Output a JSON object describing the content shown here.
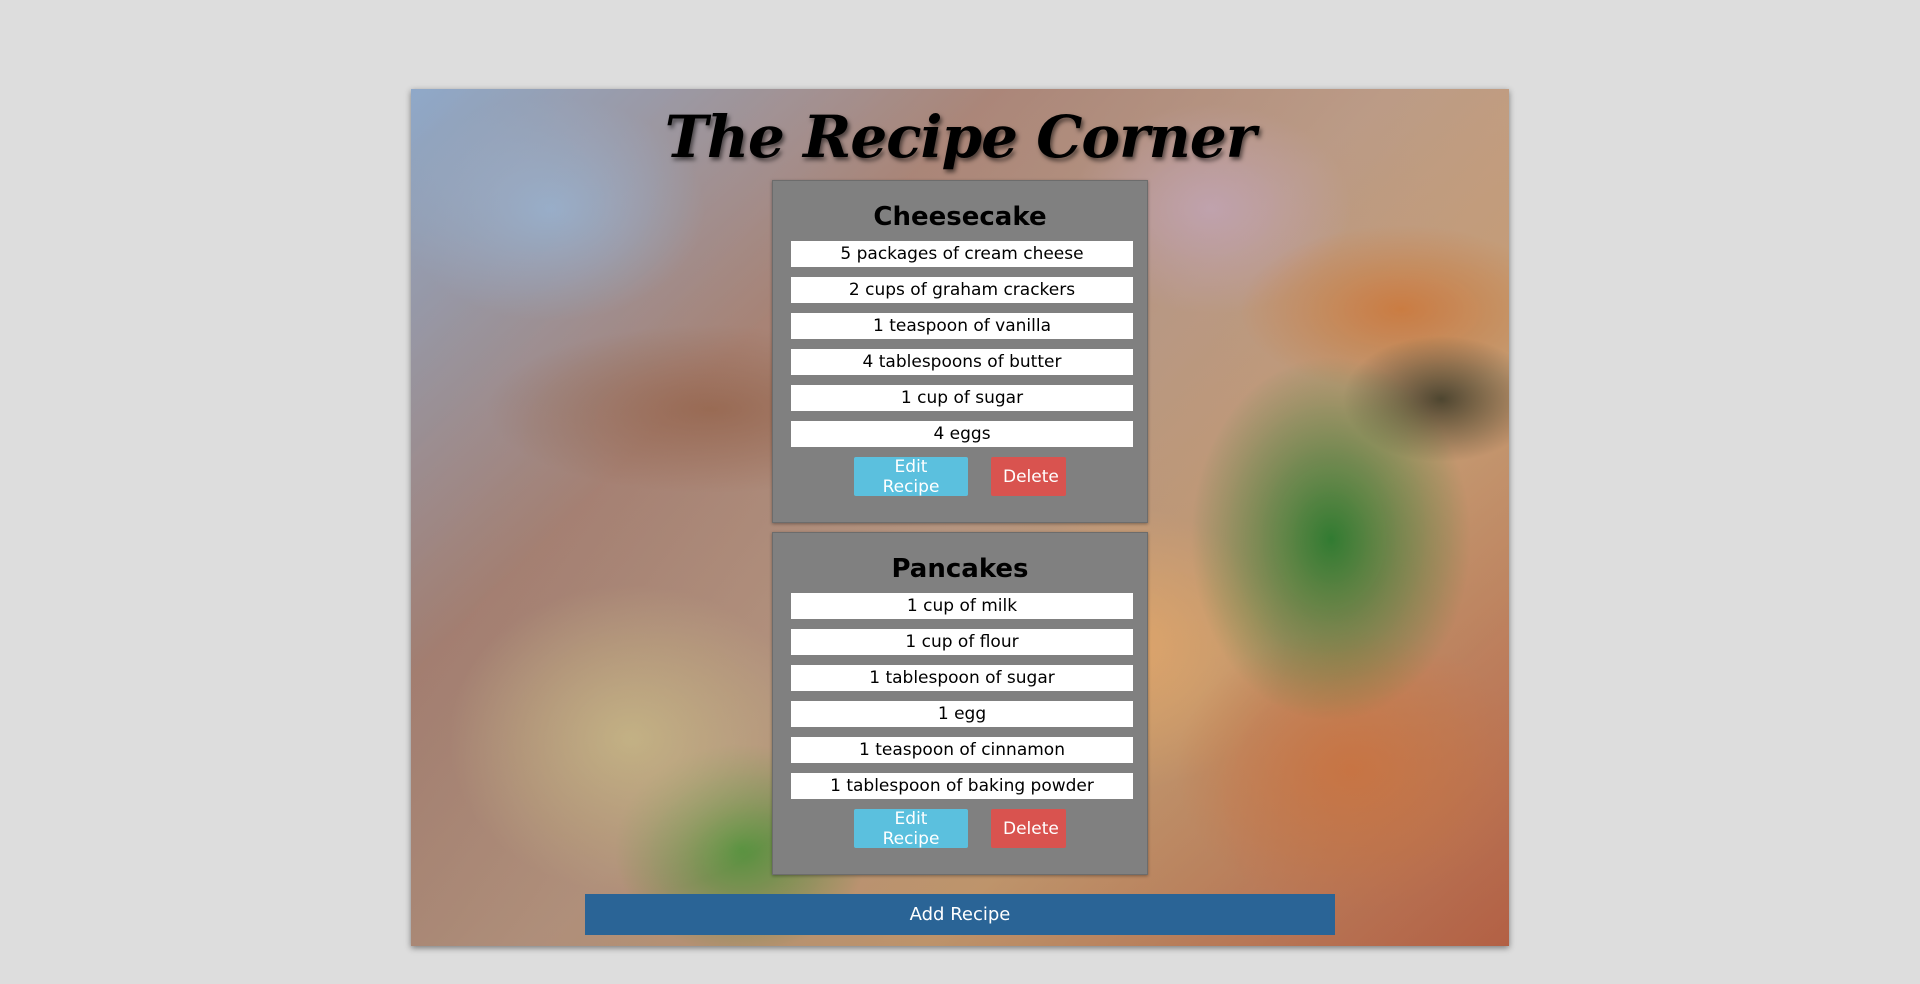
{
  "app": {
    "title": "The Recipe Corner"
  },
  "recipes": [
    {
      "name": "Cheesecake",
      "ingredients": [
        "5 packages of cream cheese",
        "2 cups of graham crackers",
        "1 teaspoon of vanilla",
        "4 tablespoons of butter",
        "1 cup of sugar",
        "4 eggs"
      ],
      "edit_label": "Edit Recipe",
      "delete_label": "Delete"
    },
    {
      "name": "Pancakes",
      "ingredients": [
        "1 cup of milk",
        "1 cup of flour",
        "1 tablespoon of sugar",
        "1 egg",
        "1 teaspoon of cinnamon",
        "1 tablespoon of baking powder"
      ],
      "edit_label": "Edit Recipe",
      "delete_label": "Delete"
    }
  ],
  "footer": {
    "add_label": "Add Recipe"
  },
  "colors": {
    "page_background": "#dddddd",
    "card_background": "#808080",
    "edit_button": "#5bc0de",
    "delete_button": "#d9534f",
    "add_button": "#2a6496"
  }
}
